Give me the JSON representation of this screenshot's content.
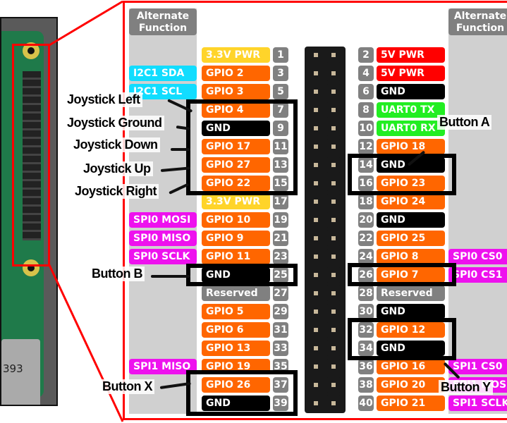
{
  "board": {
    "usb_text": "393"
  },
  "alt_title": "Alternate Function",
  "colors": {
    "power33": "#ffd42a",
    "power5": "#ff0000",
    "gpio": "#ff6600",
    "gnd": "#000000",
    "uart": "#22ee22",
    "reserved": "#808080",
    "i2c": "#11ddff",
    "spi": "#ee11ee",
    "frame": "#ff0000"
  },
  "left_pins": [
    {
      "num": "1",
      "name": "3.3V PWR",
      "type": "power33"
    },
    {
      "num": "3",
      "name": "GPIO 2",
      "type": "gpio"
    },
    {
      "num": "5",
      "name": "GPIO 3",
      "type": "gpio"
    },
    {
      "num": "7",
      "name": "GPIO 4",
      "type": "gpio"
    },
    {
      "num": "9",
      "name": "GND",
      "type": "gnd"
    },
    {
      "num": "11",
      "name": "GPIO 17",
      "type": "gpio"
    },
    {
      "num": "13",
      "name": "GPIO 27",
      "type": "gpio"
    },
    {
      "num": "15",
      "name": "GPIO 22",
      "type": "gpio"
    },
    {
      "num": "17",
      "name": "3.3V PWR",
      "type": "power33"
    },
    {
      "num": "19",
      "name": "GPIO 10",
      "type": "gpio"
    },
    {
      "num": "21",
      "name": "GPIO 9",
      "type": "gpio"
    },
    {
      "num": "23",
      "name": "GPIO 11",
      "type": "gpio"
    },
    {
      "num": "25",
      "name": "GND",
      "type": "gnd"
    },
    {
      "num": "27",
      "name": "Reserved",
      "type": "reserved"
    },
    {
      "num": "29",
      "name": "GPIO 5",
      "type": "gpio"
    },
    {
      "num": "31",
      "name": "GPIO 6",
      "type": "gpio"
    },
    {
      "num": "33",
      "name": "GPIO 13",
      "type": "gpio"
    },
    {
      "num": "35",
      "name": "GPIO 19",
      "type": "gpio"
    },
    {
      "num": "37",
      "name": "GPIO 26",
      "type": "gpio"
    },
    {
      "num": "39",
      "name": "GND",
      "type": "gnd"
    }
  ],
  "right_pins": [
    {
      "num": "2",
      "name": "5V PWR",
      "type": "power5"
    },
    {
      "num": "4",
      "name": "5V PWR",
      "type": "power5"
    },
    {
      "num": "6",
      "name": "GND",
      "type": "gnd"
    },
    {
      "num": "8",
      "name": "UART0 TX",
      "type": "uart"
    },
    {
      "num": "10",
      "name": "UART0 RX",
      "type": "uart"
    },
    {
      "num": "12",
      "name": "GPIO 18",
      "type": "gpio"
    },
    {
      "num": "14",
      "name": "GND",
      "type": "gnd"
    },
    {
      "num": "16",
      "name": "GPIO 23",
      "type": "gpio"
    },
    {
      "num": "18",
      "name": "GPIO 24",
      "type": "gpio"
    },
    {
      "num": "20",
      "name": "GND",
      "type": "gnd"
    },
    {
      "num": "22",
      "name": "GPIO 25",
      "type": "gpio"
    },
    {
      "num": "24",
      "name": "GPIO 8",
      "type": "gpio"
    },
    {
      "num": "26",
      "name": "GPIO 7",
      "type": "gpio"
    },
    {
      "num": "28",
      "name": "Reserved",
      "type": "reserved"
    },
    {
      "num": "30",
      "name": "GND",
      "type": "gnd"
    },
    {
      "num": "32",
      "name": "GPIO 12",
      "type": "gpio"
    },
    {
      "num": "34",
      "name": "GND",
      "type": "gnd"
    },
    {
      "num": "36",
      "name": "GPIO 16",
      "type": "gpio"
    },
    {
      "num": "38",
      "name": "GPIO 20",
      "type": "gpio"
    },
    {
      "num": "40",
      "name": "GPIO 21",
      "type": "gpio"
    }
  ],
  "left_alt": [
    {
      "row": 2,
      "name": "I2C1 SDA",
      "type": "i2c"
    },
    {
      "row": 3,
      "name": "I2C1 SCL",
      "type": "i2c"
    },
    {
      "row": 10,
      "name": "SPI0 MOSI",
      "type": "spi"
    },
    {
      "row": 11,
      "name": "SPI0 MISO",
      "type": "spi"
    },
    {
      "row": 12,
      "name": "SPI0 SCLK",
      "type": "spi"
    },
    {
      "row": 18,
      "name": "SPI1 MISO",
      "type": "spi"
    }
  ],
  "right_alt": [
    {
      "row": 12,
      "name": "SPI0 CS0",
      "type": "spi"
    },
    {
      "row": 13,
      "name": "SPI0 CS1",
      "type": "spi"
    },
    {
      "row": 18,
      "name": "SPI1 CS0",
      "type": "spi"
    },
    {
      "row": 19,
      "name": "SPI1 MOSI",
      "type": "spi"
    },
    {
      "row": 20,
      "name": "SPI1 SCLK",
      "type": "spi"
    }
  ],
  "labels": {
    "joystick_left": "Joystick Left",
    "joystick_ground": "Joystick Ground",
    "joystick_down": "Joystick Down",
    "joystick_up": "Joystick Up",
    "joystick_right": "Joystick Right",
    "button_b": "Button B",
    "button_x": "Button X",
    "button_a": "Button A",
    "button_y": "Button Y"
  }
}
